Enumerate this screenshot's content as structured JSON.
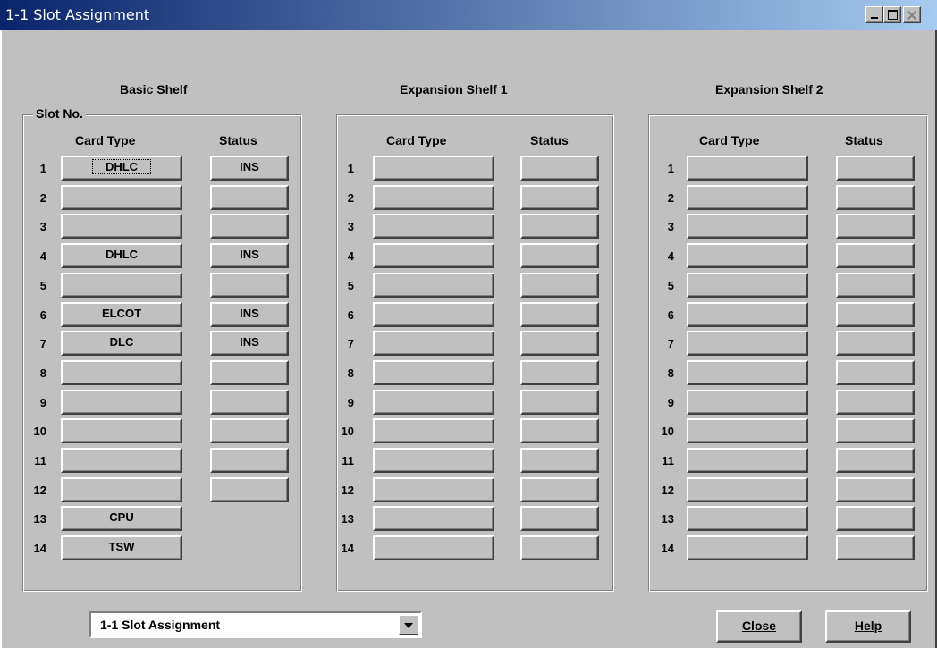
{
  "window": {
    "title": "1-1 Slot Assignment"
  },
  "legend": "Slot No.",
  "col_card": "Card Type",
  "col_status": "Status",
  "shelves": [
    {
      "title": "Basic Shelf",
      "slots": [
        {
          "num": "1",
          "card": "DHLC",
          "status": "INS"
        },
        {
          "num": "2",
          "card": "",
          "status": ""
        },
        {
          "num": "3",
          "card": "",
          "status": ""
        },
        {
          "num": "4",
          "card": "DHLC",
          "status": "INS"
        },
        {
          "num": "5",
          "card": "",
          "status": ""
        },
        {
          "num": "6",
          "card": "ELCOT",
          "status": "INS"
        },
        {
          "num": "7",
          "card": "DLC",
          "status": "INS"
        },
        {
          "num": "8",
          "card": "",
          "status": ""
        },
        {
          "num": "9",
          "card": "",
          "status": ""
        },
        {
          "num": "10",
          "card": "",
          "status": ""
        },
        {
          "num": "11",
          "card": "",
          "status": ""
        },
        {
          "num": "12",
          "card": "",
          "status": ""
        },
        {
          "num": "13",
          "card": "CPU",
          "status": null
        },
        {
          "num": "14",
          "card": "TSW",
          "status": null
        }
      ]
    },
    {
      "title": "Expansion Shelf 1",
      "slots": [
        {
          "num": "1",
          "card": "",
          "status": ""
        },
        {
          "num": "2",
          "card": "",
          "status": ""
        },
        {
          "num": "3",
          "card": "",
          "status": ""
        },
        {
          "num": "4",
          "card": "",
          "status": ""
        },
        {
          "num": "5",
          "card": "",
          "status": ""
        },
        {
          "num": "6",
          "card": "",
          "status": ""
        },
        {
          "num": "7",
          "card": "",
          "status": ""
        },
        {
          "num": "8",
          "card": "",
          "status": ""
        },
        {
          "num": "9",
          "card": "",
          "status": ""
        },
        {
          "num": "10",
          "card": "",
          "status": ""
        },
        {
          "num": "11",
          "card": "",
          "status": ""
        },
        {
          "num": "12",
          "card": "",
          "status": ""
        },
        {
          "num": "13",
          "card": "",
          "status": ""
        },
        {
          "num": "14",
          "card": "",
          "status": ""
        }
      ]
    },
    {
      "title": "Expansion Shelf 2",
      "slots": [
        {
          "num": "1",
          "card": "",
          "status": ""
        },
        {
          "num": "2",
          "card": "",
          "status": ""
        },
        {
          "num": "3",
          "card": "",
          "status": ""
        },
        {
          "num": "4",
          "card": "",
          "status": ""
        },
        {
          "num": "5",
          "card": "",
          "status": ""
        },
        {
          "num": "6",
          "card": "",
          "status": ""
        },
        {
          "num": "7",
          "card": "",
          "status": ""
        },
        {
          "num": "8",
          "card": "",
          "status": ""
        },
        {
          "num": "9",
          "card": "",
          "status": ""
        },
        {
          "num": "10",
          "card": "",
          "status": ""
        },
        {
          "num": "11",
          "card": "",
          "status": ""
        },
        {
          "num": "12",
          "card": "",
          "status": ""
        },
        {
          "num": "13",
          "card": "",
          "status": ""
        },
        {
          "num": "14",
          "card": "",
          "status": ""
        }
      ]
    }
  ],
  "menu_select": {
    "value": "1-1 Slot Assignment"
  },
  "buttons": {
    "close": "Close",
    "help": "Help"
  },
  "colors": {
    "face": "#c0c0c0",
    "title_start": "#0a246a",
    "title_end": "#a6caf0"
  }
}
